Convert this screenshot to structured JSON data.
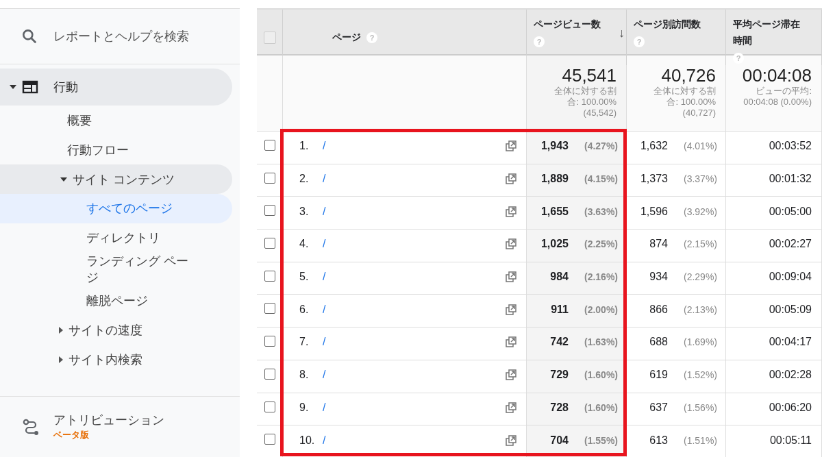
{
  "sidebar": {
    "search": {
      "placeholder": "レポートとヘルプを検索"
    },
    "nav": [
      {
        "label": "行動",
        "expanded": true,
        "selected": false,
        "children": [
          {
            "label": "概要",
            "selected": false
          },
          {
            "label": "行動フロー",
            "selected": false
          },
          {
            "label": "サイト コンテンツ",
            "expanded": true,
            "selected": false,
            "children": [
              {
                "label": "すべてのページ",
                "selected": true
              },
              {
                "label": "ディレクトリ",
                "selected": false
              },
              {
                "label": "ランディング ページ",
                "selected": false
              },
              {
                "label": "離脱ページ",
                "selected": false
              }
            ]
          },
          {
            "label": "サイトの速度",
            "expanded": false,
            "selected": false
          },
          {
            "label": "サイト内検索",
            "expanded": false,
            "selected": false
          }
        ]
      }
    ],
    "attribution": {
      "label": "アトリビューション",
      "badge": "ベータ版"
    }
  },
  "table": {
    "columns": [
      {
        "label": "ページ",
        "help": "?"
      },
      {
        "label": "ページビュー数",
        "help": "?",
        "sort_icon": "↓"
      },
      {
        "label": "ページ別訪問数",
        "help": "?"
      },
      {
        "label": "平均ページ滞在時間",
        "help": "?"
      }
    ],
    "select_all": {
      "checked": false,
      "disabled": true
    },
    "summary": [
      {
        "value": "45,541",
        "note": "全体に対する割合: 100.00% (45,542)"
      },
      {
        "value": "40,726",
        "note": "全体に対する割合: 100.00% (40,727)"
      },
      {
        "value": "00:04:08",
        "note": "ビューの平均: 00:04:08 (0.00%)"
      }
    ],
    "rows": [
      {
        "checked": false,
        "rank": "1.",
        "page": "/",
        "pageviews": "1,943",
        "pageviews_pct": "(4.27%)",
        "visits": "1,632",
        "visits_pct": "(4.01%)",
        "avg_time": "00:03:52"
      },
      {
        "checked": false,
        "rank": "2.",
        "page": "/",
        "pageviews": "1,889",
        "pageviews_pct": "(4.15%)",
        "visits": "1,373",
        "visits_pct": "(3.37%)",
        "avg_time": "00:01:32"
      },
      {
        "checked": false,
        "rank": "3.",
        "page": "/",
        "pageviews": "1,655",
        "pageviews_pct": "(3.63%)",
        "visits": "1,596",
        "visits_pct": "(3.92%)",
        "avg_time": "00:05:00"
      },
      {
        "checked": false,
        "rank": "4.",
        "page": "/",
        "pageviews": "1,025",
        "pageviews_pct": "(2.25%)",
        "visits": "874",
        "visits_pct": "(2.15%)",
        "avg_time": "00:02:27"
      },
      {
        "checked": false,
        "rank": "5.",
        "page": "/",
        "pageviews": "984",
        "pageviews_pct": "(2.16%)",
        "visits": "934",
        "visits_pct": "(2.29%)",
        "avg_time": "00:09:04"
      },
      {
        "checked": false,
        "rank": "6.",
        "page": "/",
        "pageviews": "911",
        "pageviews_pct": "(2.00%)",
        "visits": "866",
        "visits_pct": "(2.13%)",
        "avg_time": "00:05:09"
      },
      {
        "checked": false,
        "rank": "7.",
        "page": "/",
        "pageviews": "742",
        "pageviews_pct": "(1.63%)",
        "visits": "688",
        "visits_pct": "(1.69%)",
        "avg_time": "00:04:17"
      },
      {
        "checked": false,
        "rank": "8.",
        "page": "/",
        "pageviews": "729",
        "pageviews_pct": "(1.60%)",
        "visits": "619",
        "visits_pct": "(1.52%)",
        "avg_time": "00:02:28"
      },
      {
        "checked": false,
        "rank": "9.",
        "page": "/",
        "pageviews": "728",
        "pageviews_pct": "(1.60%)",
        "visits": "637",
        "visits_pct": "(1.56%)",
        "avg_time": "00:06:20"
      },
      {
        "checked": false,
        "rank": "10.",
        "page": "/",
        "pageviews": "704",
        "pageviews_pct": "(1.55%)",
        "visits": "613",
        "visits_pct": "(1.51%)",
        "avg_time": "00:05:11"
      }
    ]
  }
}
